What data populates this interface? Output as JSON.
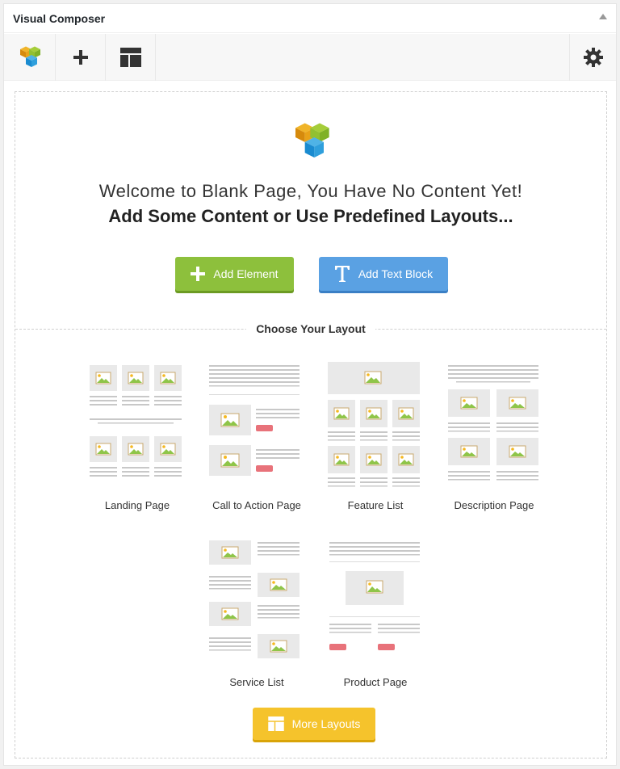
{
  "panel": {
    "title": "Visual Composer"
  },
  "toolbar": {
    "logo_icon": "vc-logo-icon",
    "add_icon": "plus-icon",
    "templates_icon": "layout-templates-icon",
    "settings_icon": "gear-icon"
  },
  "welcome": {
    "line1": "Welcome to Blank Page, You Have No Content Yet!",
    "line2": "Add Some Content or Use Predefined Layouts..."
  },
  "actions": {
    "add_element": "Add Element",
    "add_text_block": "Add Text Block",
    "more_layouts": "More Layouts"
  },
  "layouts": {
    "title": "Choose Your Layout",
    "items": [
      {
        "label": "Landing Page"
      },
      {
        "label": "Call to Action Page"
      },
      {
        "label": "Feature List"
      },
      {
        "label": "Description Page"
      },
      {
        "label": "Service List"
      },
      {
        "label": "Product Page"
      }
    ]
  },
  "colors": {
    "add_element": "#8dc03c",
    "add_text_block": "#5aa1e3",
    "more_layouts": "#f5c32c",
    "placeholder": "#e9e9e9",
    "cta_red": "#e8727a"
  }
}
